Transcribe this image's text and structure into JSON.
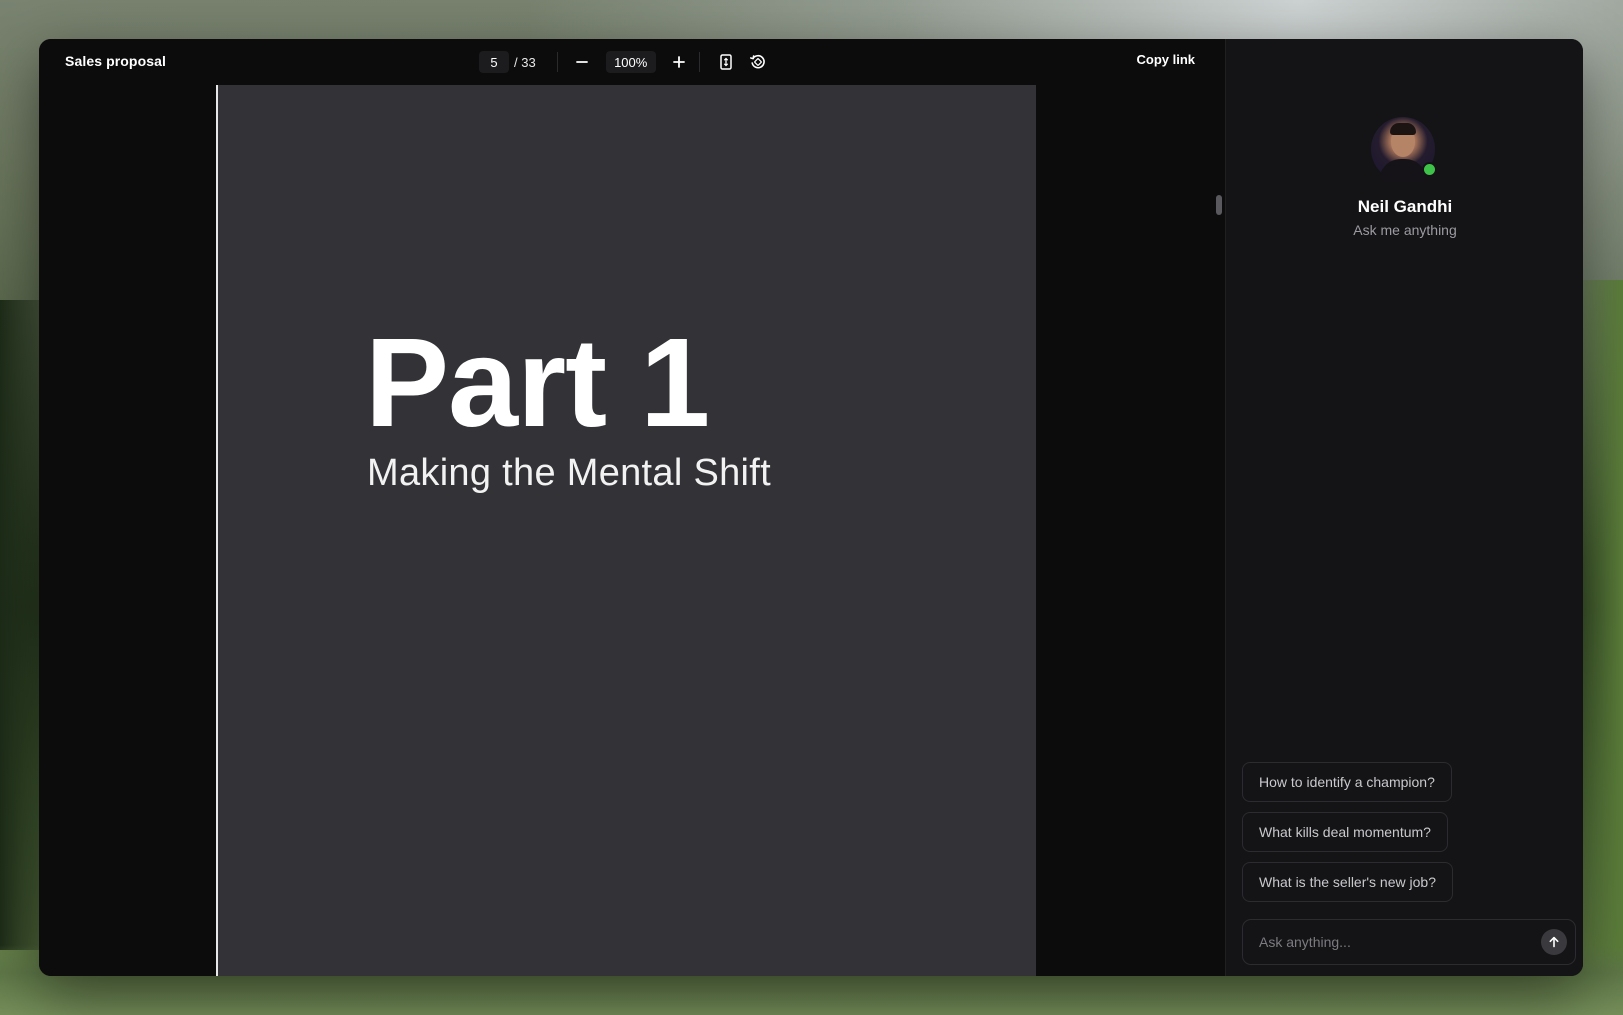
{
  "viewer": {
    "document_title": "Sales proposal",
    "current_page": "5",
    "total_pages": "/ 33",
    "zoom_level": "100%",
    "copy_link_label": "Copy link",
    "page": {
      "heading": "Part 1",
      "subheading": "Making the Mental Shift"
    }
  },
  "chat": {
    "agent_name": "Neil Gandhi",
    "agent_subtitle": "Ask me anything",
    "agent_status": "online",
    "suggestions": [
      {
        "label": "How to identify a champion?"
      },
      {
        "label": "What kills deal momentum?"
      },
      {
        "label": "What is the seller's new job?"
      }
    ],
    "input_placeholder": "Ask anything..."
  },
  "icons": {
    "zoom_out": "minus-icon",
    "zoom_in": "plus-icon",
    "fit_page": "fit-page-icon",
    "rotate": "rotate-icon",
    "send": "arrow-up-icon"
  },
  "colors": {
    "window_bg": "#0c0c0d",
    "page_bg": "#323237",
    "chat_bg": "#141416",
    "status_online": "#3ec24a"
  }
}
